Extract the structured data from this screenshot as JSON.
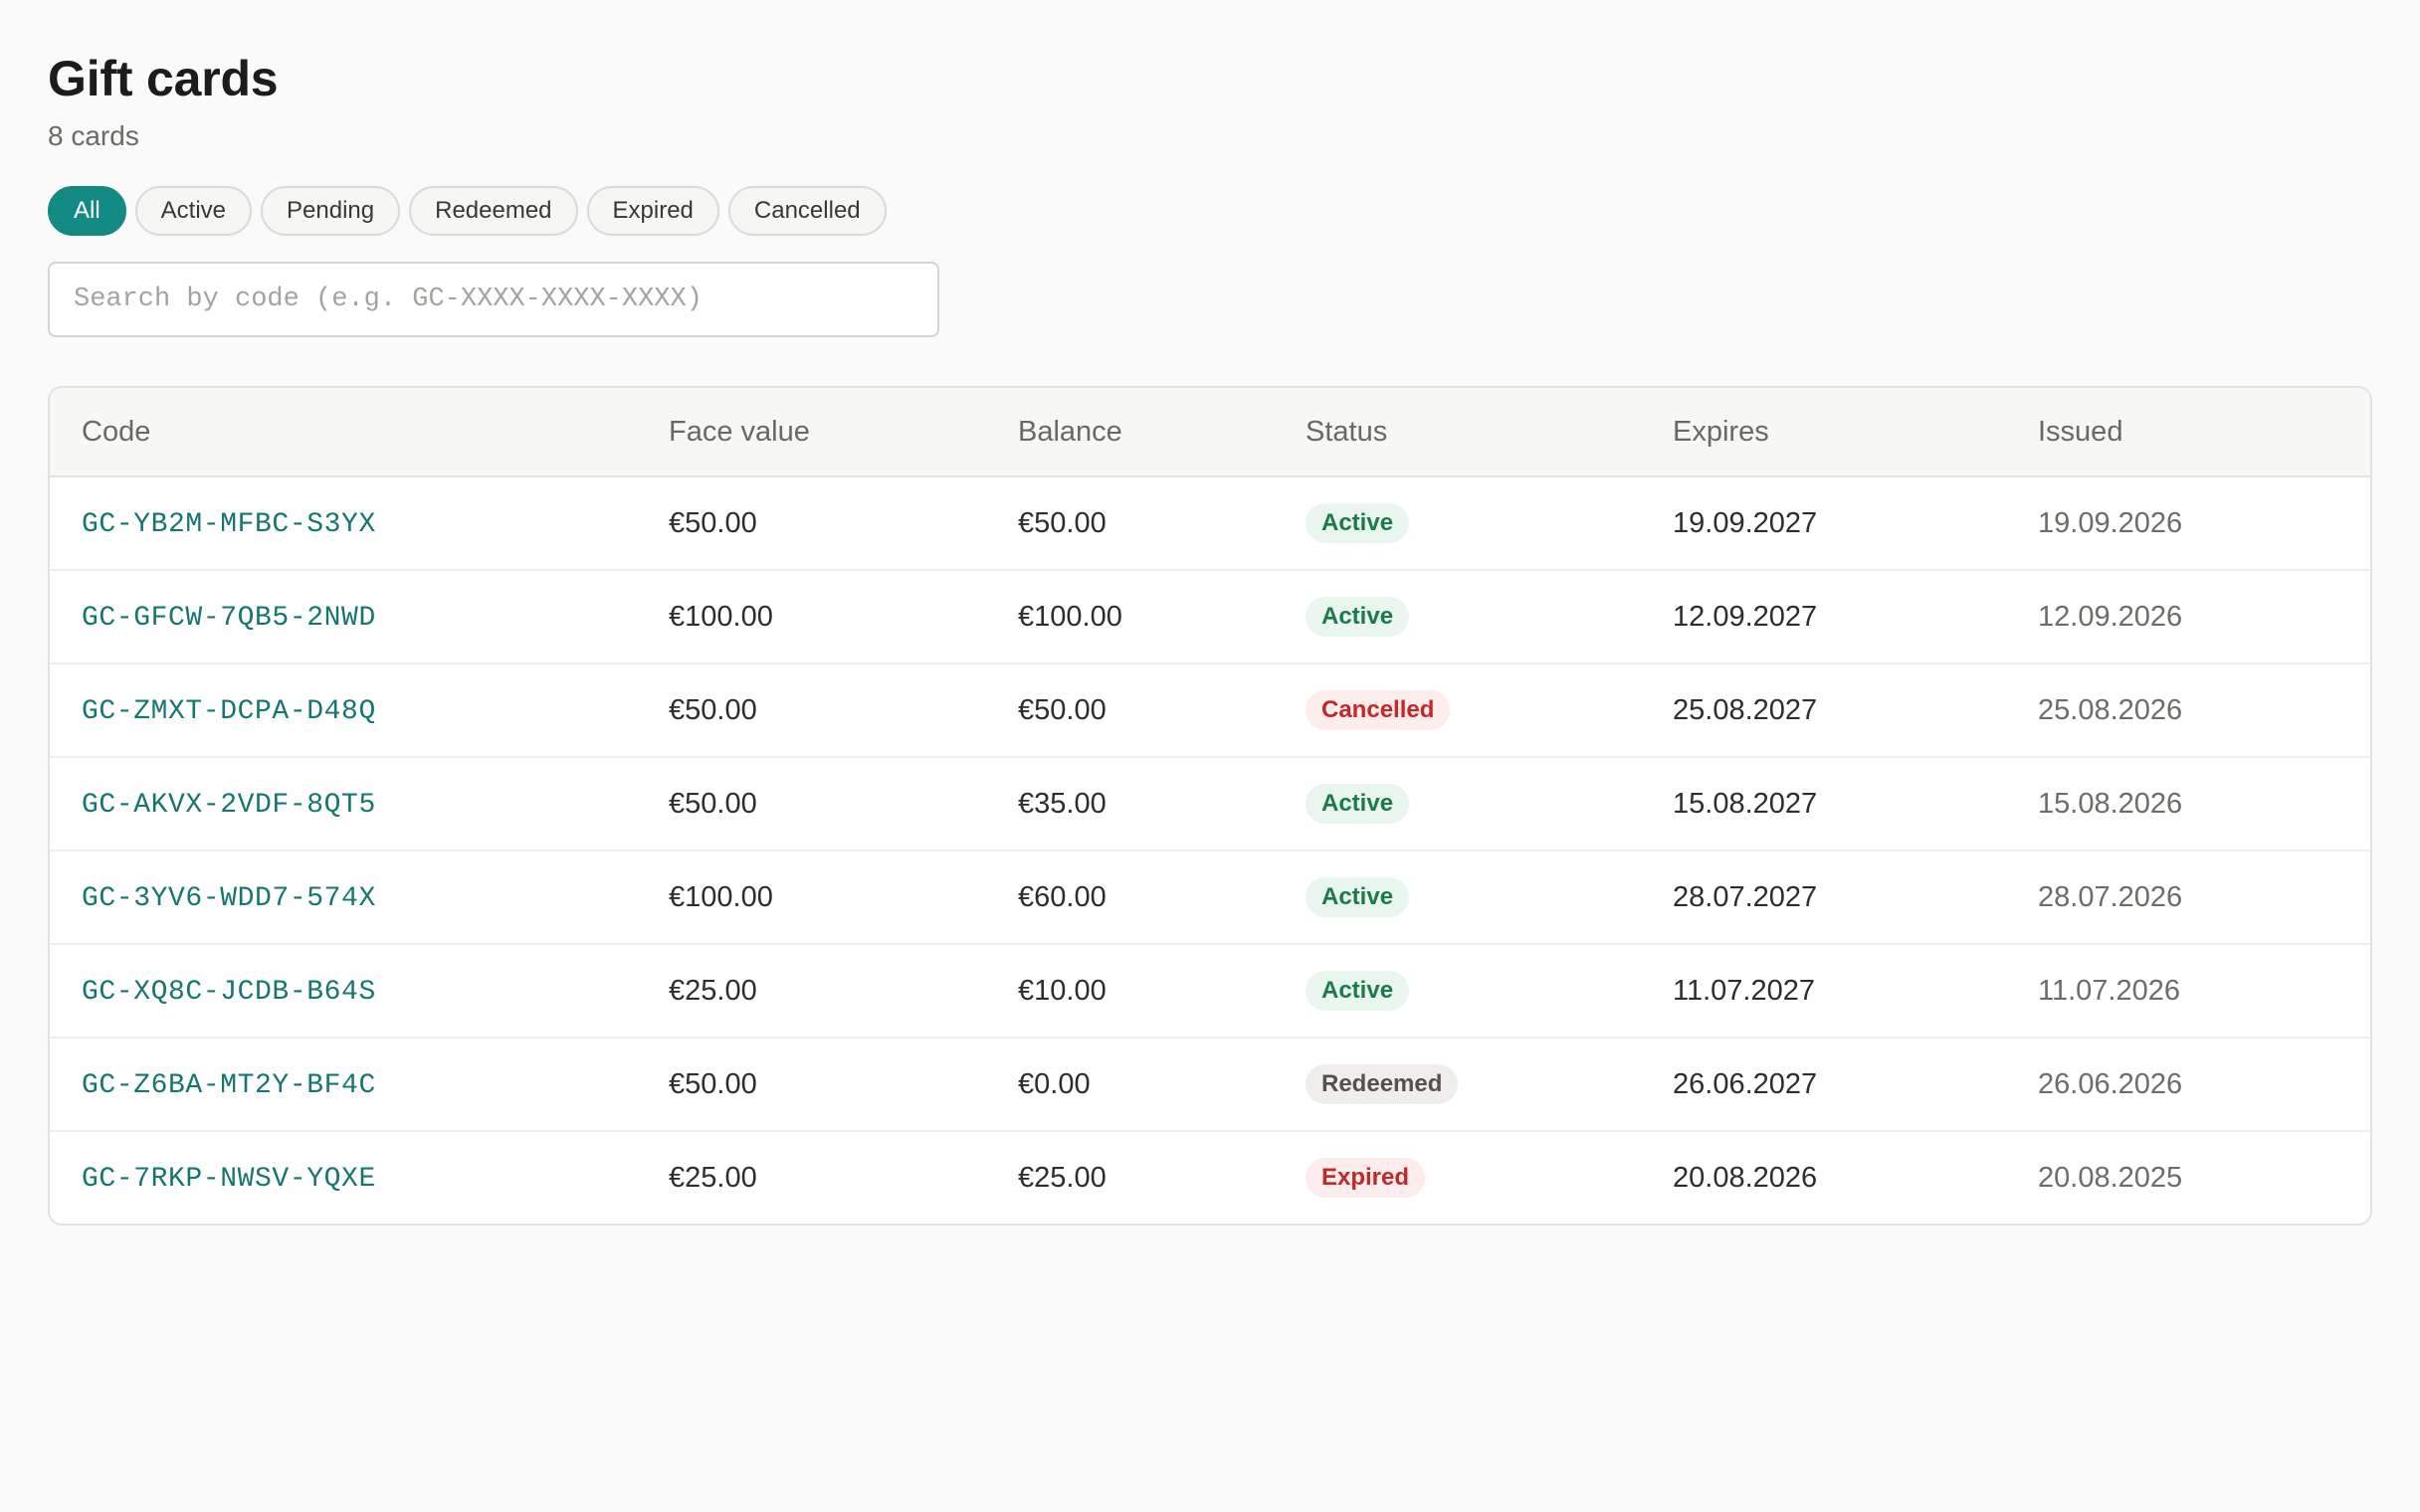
{
  "header": {
    "title": "Gift cards",
    "count_label": "8 cards"
  },
  "filters": [
    {
      "label": "All",
      "selected": true
    },
    {
      "label": "Active",
      "selected": false
    },
    {
      "label": "Pending",
      "selected": false
    },
    {
      "label": "Redeemed",
      "selected": false
    },
    {
      "label": "Expired",
      "selected": false
    },
    {
      "label": "Cancelled",
      "selected": false
    }
  ],
  "search": {
    "placeholder": "Search by code (e.g. GC-XXXX-XXXX-XXXX)",
    "value": ""
  },
  "table": {
    "columns": [
      "Code",
      "Face value",
      "Balance",
      "Status",
      "Expires",
      "Issued"
    ],
    "rows": [
      {
        "code": "GC-YB2M-MFBC-S3YX",
        "face_value": "€50.00",
        "balance": "€50.00",
        "status": "Active",
        "expires": "19.09.2027",
        "issued": "19.09.2026"
      },
      {
        "code": "GC-GFCW-7QB5-2NWD",
        "face_value": "€100.00",
        "balance": "€100.00",
        "status": "Active",
        "expires": "12.09.2027",
        "issued": "12.09.2026"
      },
      {
        "code": "GC-ZMXT-DCPA-D48Q",
        "face_value": "€50.00",
        "balance": "€50.00",
        "status": "Cancelled",
        "expires": "25.08.2027",
        "issued": "25.08.2026"
      },
      {
        "code": "GC-AKVX-2VDF-8QT5",
        "face_value": "€50.00",
        "balance": "€35.00",
        "status": "Active",
        "expires": "15.08.2027",
        "issued": "15.08.2026"
      },
      {
        "code": "GC-3YV6-WDD7-574X",
        "face_value": "€100.00",
        "balance": "€60.00",
        "status": "Active",
        "expires": "28.07.2027",
        "issued": "28.07.2026"
      },
      {
        "code": "GC-XQ8C-JCDB-B64S",
        "face_value": "€25.00",
        "balance": "€10.00",
        "status": "Active",
        "expires": "11.07.2027",
        "issued": "11.07.2026"
      },
      {
        "code": "GC-Z6BA-MT2Y-BF4C",
        "face_value": "€50.00",
        "balance": "€0.00",
        "status": "Redeemed",
        "expires": "26.06.2027",
        "issued": "26.06.2026"
      },
      {
        "code": "GC-7RKP-NWSV-YQXE",
        "face_value": "€25.00",
        "balance": "€25.00",
        "status": "Expired",
        "expires": "20.08.2026",
        "issued": "20.08.2025"
      }
    ]
  },
  "colors": {
    "accent": "#138a84",
    "code_link": "#17756f",
    "status_active_bg": "#e8f6ee",
    "status_active_text": "#1c7a4a",
    "status_cancelled_bg": "#fdecec",
    "status_cancelled_text": "#c0282a",
    "status_redeemed_bg": "#efeeec",
    "status_redeemed_text": "#55524e"
  }
}
